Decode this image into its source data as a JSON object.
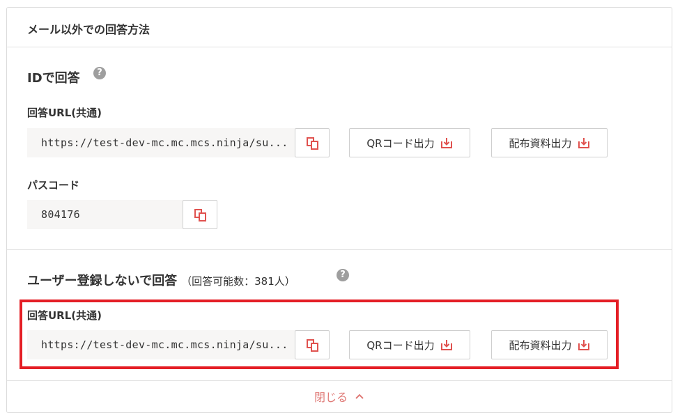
{
  "panel": {
    "title": "メール以外での回答方法"
  },
  "id_section": {
    "title": "IDで回答",
    "help": "?",
    "url_label": "回答URL(共通)",
    "url_value": "https://test-dev-mc.mc.mcs.ninja/su...",
    "qr_button": "QRコード出力",
    "doc_button": "配布資料出力",
    "passcode_label": "パスコード",
    "passcode_value": "804176"
  },
  "noreg_section": {
    "title": "ユーザー登録しないで回答",
    "count_text": "（回答可能数：381人）",
    "help": "?",
    "url_label": "回答URL(共通)",
    "url_value": "https://test-dev-mc.mc.mcs.ninja/su...",
    "qr_button": "QRコード出力",
    "doc_button": "配布資料出力"
  },
  "footer": {
    "close_label": "閉じる"
  },
  "colors": {
    "accent": "#e0524f",
    "highlight": "#e41e25",
    "close_text": "#e07b78"
  },
  "icons": {
    "copy": "copy-icon",
    "download": "download-icon",
    "chevron": "chevron-up-icon",
    "help": "question-icon"
  }
}
